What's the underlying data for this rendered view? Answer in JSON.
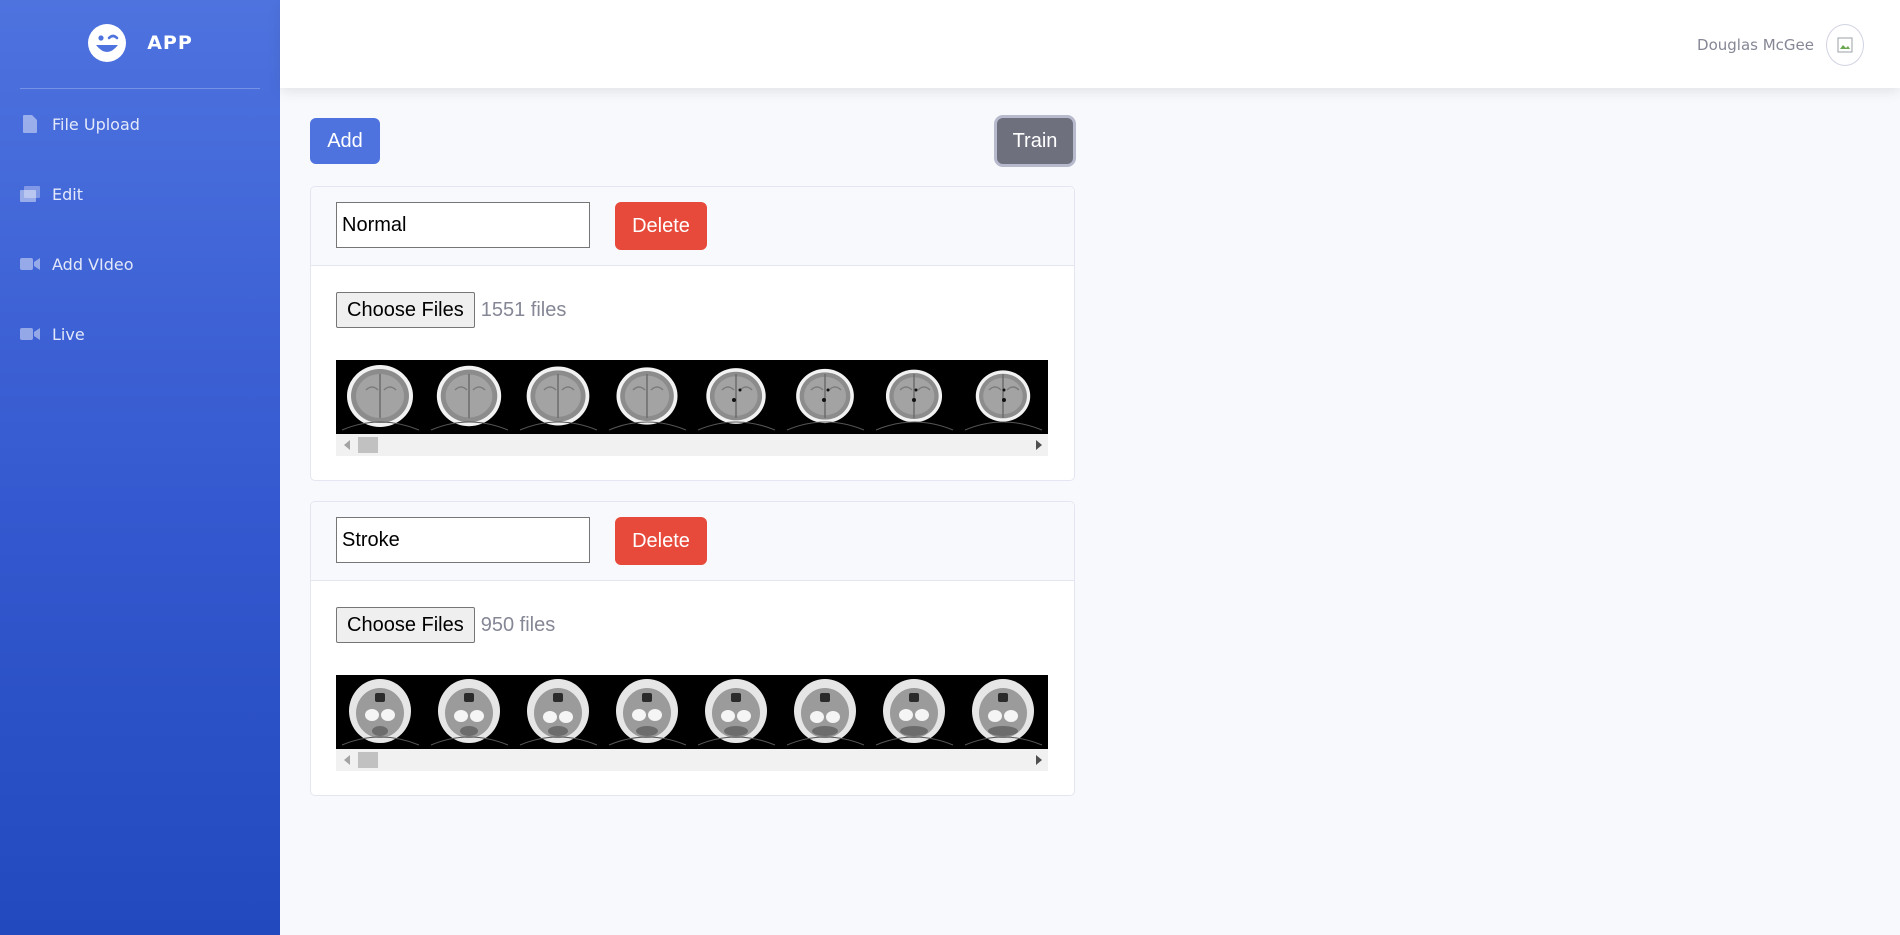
{
  "app": {
    "brand": "APP"
  },
  "sidebar": {
    "items": [
      {
        "label": "File Upload",
        "icon": "file-icon"
      },
      {
        "label": "Edit",
        "icon": "images-icon"
      },
      {
        "label": "Add VIdeo",
        "icon": "video-camera-icon"
      },
      {
        "label": "Live",
        "icon": "video-camera-icon"
      }
    ]
  },
  "topbar": {
    "user_name": "Douglas McGee"
  },
  "toolbar": {
    "add_label": "Add",
    "train_label": "Train"
  },
  "classes": [
    {
      "label": "Normal",
      "delete_label": "Delete",
      "choose_label": "Choose Files",
      "file_count": "1551 files",
      "thumbnails": 8
    },
    {
      "label": "Stroke",
      "delete_label": "Delete",
      "choose_label": "Choose Files",
      "file_count": "950 files",
      "thumbnails": 8
    }
  ],
  "colors": {
    "primary": "#4e73df",
    "danger": "#e74a3b",
    "secondary": "#6e707e",
    "muted_text": "#858796"
  }
}
